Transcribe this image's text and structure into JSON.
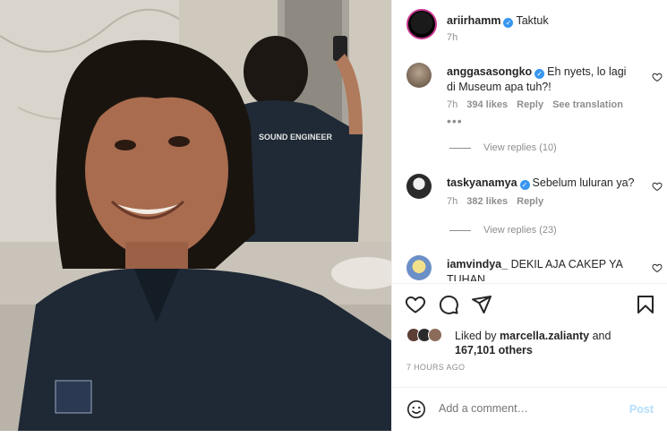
{
  "post": {
    "author": "ariirhamm",
    "caption": "Taktuk",
    "time_ago": "7h",
    "photo_shirt_text": "SOUND ENGINEER"
  },
  "comments": [
    {
      "username": "anggasasongko",
      "verified": true,
      "text": "Eh nyets, lo lagi di Museum apa tuh?!",
      "time": "7h",
      "likes": "394 likes",
      "reply": "Reply",
      "translate": "See translation",
      "more": "•••",
      "view_replies": "View replies (10)"
    },
    {
      "username": "taskyanamya",
      "verified": true,
      "text": "Sebelum luluran ya?",
      "time": "7h",
      "likes": "382 likes",
      "reply": "Reply",
      "view_replies": "View replies (23)"
    },
    {
      "username": "iamvindya_",
      "verified": false,
      "text": "DEKIL AJA CAKEP YA TUHAN"
    }
  ],
  "likes": {
    "prefix": "Liked by",
    "user": "marcella.zalianty",
    "and": "and",
    "others": "167,101 others"
  },
  "posted_ago": "7 HOURS AGO",
  "add_comment": {
    "placeholder": "Add a comment…",
    "post_label": "Post"
  },
  "icons": {
    "verified": "verified-badge-icon",
    "like": "heart-icon",
    "comment": "comment-bubble-icon",
    "share": "paper-plane-icon",
    "save": "bookmark-icon",
    "emoji": "smiley-icon"
  },
  "colors": {
    "verified_blue": "#3897f0",
    "secondary_text": "#8e8e8e",
    "post_button_disabled": "#b2dffc"
  }
}
